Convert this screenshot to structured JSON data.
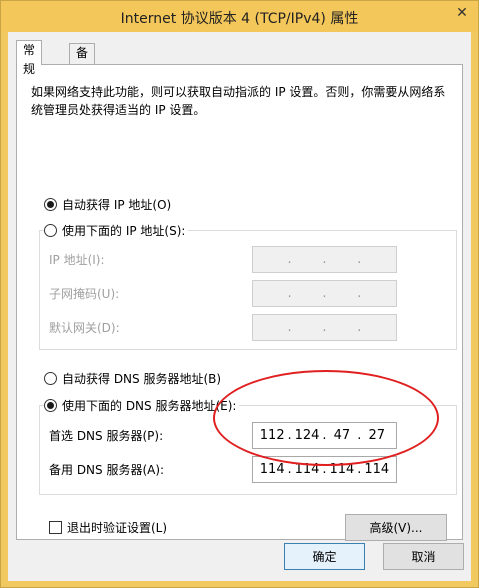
{
  "window": {
    "title": "Internet 协议版本 4 (TCP/IPv4) 属性",
    "close_glyph": "✕"
  },
  "tabs": [
    {
      "label": "常规",
      "active": true
    },
    {
      "label": "备用配置",
      "active": false
    }
  ],
  "description": "如果网络支持此功能，则可以获取自动指派的 IP 设置。否则，你需要从网络系统管理员处获得适当的 IP 设置。",
  "ip": {
    "auto_label": "自动获得 IP 地址(O)",
    "auto_selected": true,
    "manual_label": "使用下面的 IP 地址(S):",
    "manual_selected": false,
    "address_label": "IP 地址(I):",
    "subnet_label": "子网掩码(U):",
    "gateway_label": "默认网关(D):"
  },
  "dns": {
    "auto_label": "自动获得 DNS 服务器地址(B)",
    "auto_selected": false,
    "manual_label": "使用下面的 DNS 服务器地址(E):",
    "manual_selected": true,
    "preferred_label": "首选 DNS 服务器(P):",
    "preferred_value": [
      "112",
      "124",
      "47",
      "27"
    ],
    "alternate_label": "备用 DNS 服务器(A):",
    "alternate_value": [
      "114",
      "114",
      "114",
      "114"
    ]
  },
  "validate": {
    "label": "退出时验证设置(L)",
    "checked": false
  },
  "buttons": {
    "advanced": "高级(V)...",
    "ok": "确定",
    "cancel": "取消"
  },
  "ip_separator": ".",
  "colors": {
    "titlebar": "#f4c75a",
    "annotation": "#e02020",
    "default_button_border": "#3c7fb1"
  }
}
